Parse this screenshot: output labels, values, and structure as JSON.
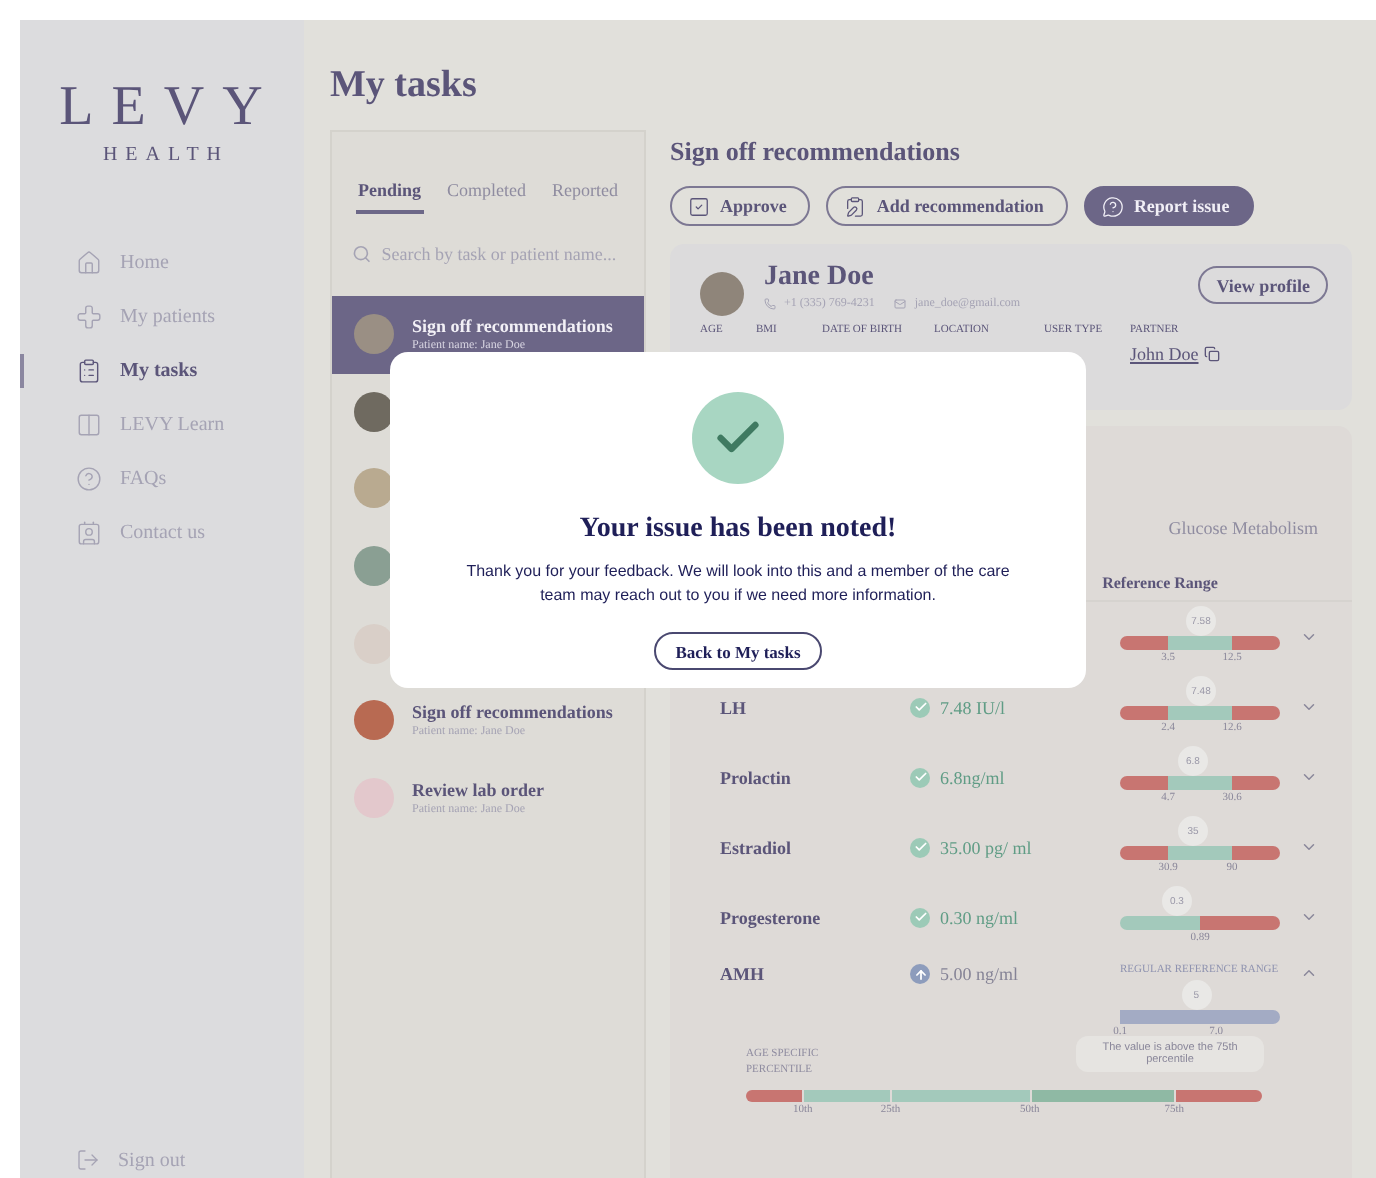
{
  "sidebar": {
    "logo": "LEVY",
    "logo_sub": "HEALTH",
    "items": [
      {
        "label": "Home",
        "selected": false
      },
      {
        "label": "My patients",
        "selected": false
      },
      {
        "label": "My tasks",
        "selected": true
      },
      {
        "label": "LEVY Learn",
        "selected": false
      },
      {
        "label": "FAQs",
        "selected": false
      },
      {
        "label": "Contact us",
        "selected": false
      }
    ],
    "sign_out": "Sign out"
  },
  "page_title": "My tasks",
  "tasks": {
    "tabs": [
      {
        "label": "Pending",
        "selected": true
      },
      {
        "label": "Completed",
        "selected": false
      },
      {
        "label": "Reported",
        "selected": false
      }
    ],
    "search": {
      "placeholder": "Search by task or patient name..."
    },
    "items": [
      {
        "title": "Sign off recommendations",
        "patient": "Patient name: Jane Doe",
        "selected": true
      },
      {
        "selected": false
      },
      {
        "selected": false
      },
      {
        "selected": false
      },
      {
        "selected": false
      },
      {
        "title": "Sign off recommendations",
        "patient": "Patient name: Jane Doe",
        "selected": false
      },
      {
        "title": "Review lab order",
        "patient": "Patient name: Jane Doe",
        "selected": false
      }
    ]
  },
  "detail": {
    "title": "Sign off recommendations",
    "actions": [
      {
        "label": "Approve",
        "kind": "outline"
      },
      {
        "label": "Add recommendation",
        "kind": "outline"
      },
      {
        "label": "Report issue",
        "kind": "filled"
      }
    ],
    "patient": {
      "name": "Jane Doe",
      "phone": "+1 (335) 769-4231",
      "email": "jane_doe@gmail.com",
      "view_profile": "View profile",
      "fields": [
        {
          "label": "AGE"
        },
        {
          "label": "BMI"
        },
        {
          "label": "DATE OF BIRTH"
        },
        {
          "label": "LOCATION"
        },
        {
          "label": "USER TYPE"
        },
        {
          "label": "PARTNER",
          "value": "John Doe"
        }
      ]
    },
    "labs": {
      "tabs": [
        {
          "label": "Glucose Metabolism",
          "selected": false
        }
      ],
      "range_header": "Reference Range",
      "rows": [
        {
          "range": {
            "kind": "mid",
            "thumb": "7.58",
            "level": 0.5,
            "ticks": [
              "3.5",
              "12.5"
            ]
          },
          "expanded": false
        },
        {
          "name": "LH",
          "in_range": true,
          "value": "7.48 IU/l",
          "range": {
            "kind": "mid",
            "thumb": "7.48",
            "level": 0.5,
            "ticks": [
              "2.4",
              "12.6"
            ]
          },
          "expanded": false
        },
        {
          "name": "Prolactin",
          "in_range": true,
          "value": "6.8ng/ml",
          "range": {
            "kind": "mid",
            "thumb": "6.8",
            "level": 0.45,
            "ticks": [
              "4.7",
              "30.6"
            ]
          },
          "expanded": false
        },
        {
          "name": "Estradiol",
          "in_range": true,
          "value": "35.00 pg/ ml",
          "range": {
            "kind": "mid",
            "thumb": "35",
            "level": 0.45,
            "ticks": [
              "30.9",
              "90"
            ]
          },
          "expanded": false
        },
        {
          "name": "Progesterone",
          "in_range": true,
          "value": "0.30 ng/ml",
          "range": {
            "kind": "low",
            "thumb": "0.3",
            "level": 0.35,
            "ticks": [
              "0.89"
            ]
          },
          "expanded": false
        },
        {
          "name": "AMH",
          "in_range": false,
          "value": "5.00 ng/ml",
          "range": {
            "kind": "plain",
            "caption": "REGULAR REFERENCE RANGE",
            "thumb": "5",
            "level": 0.47,
            "ticks": [
              "0.1",
              "7.0"
            ]
          },
          "expanded": true,
          "percentile": {
            "label": "AGE SPECIFIC PERCENTILE",
            "tooltip": "The value is above the 75th percentile",
            "ticks": [
              "10th",
              "25th",
              "50th",
              "75th"
            ]
          }
        }
      ]
    }
  },
  "modal": {
    "title": "Your issue has been noted!",
    "message": "Thank you for your feedback. We will look into this and a member of the care team may reach out to you if we need more information.",
    "button": "Back to My tasks"
  }
}
